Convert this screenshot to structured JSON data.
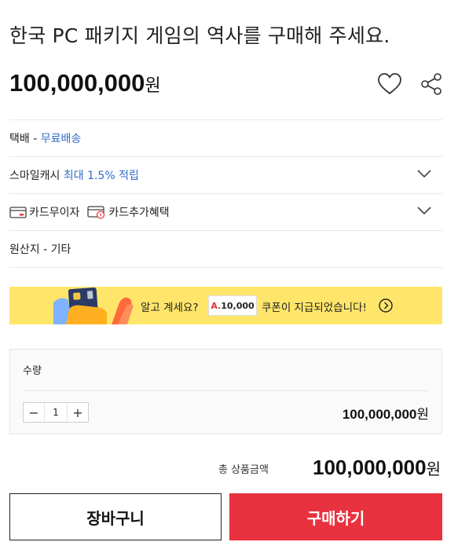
{
  "product": {
    "title": "한국 PC 패키지 게임의 역사를 구매해 주세요.",
    "price": "100,000,000",
    "currency": "원",
    "icons": [
      "heart-icon",
      "share-icon"
    ]
  },
  "shipping": {
    "label": "택배 - ",
    "value": "무료배송"
  },
  "smilecash": {
    "label": "스마일캐시 ",
    "value": "최대 1.5% 적립"
  },
  "card_benefits": {
    "items": [
      "카드무이자",
      "카드추가혜택"
    ]
  },
  "origin": {
    "text": "원산지 - 기타"
  },
  "banner": {
    "text_before": "알고 계세요?",
    "coupon_prefix": "A.",
    "coupon_value": "10,000",
    "text_after": "쿠폰이 지급되었습니다!",
    "colors": {
      "background": "#ffe66b"
    }
  },
  "quantity": {
    "label": "수량",
    "minus": "−",
    "value": "1",
    "plus": "+",
    "subtotal": "100,000,000",
    "currency": "원"
  },
  "total": {
    "label": "총 상품금액",
    "price": "100,000,000",
    "currency": "원"
  },
  "actions": {
    "cart_label": "장바구니",
    "buy_label": "구매하기",
    "colors": {
      "buy": "#e8323f"
    }
  }
}
